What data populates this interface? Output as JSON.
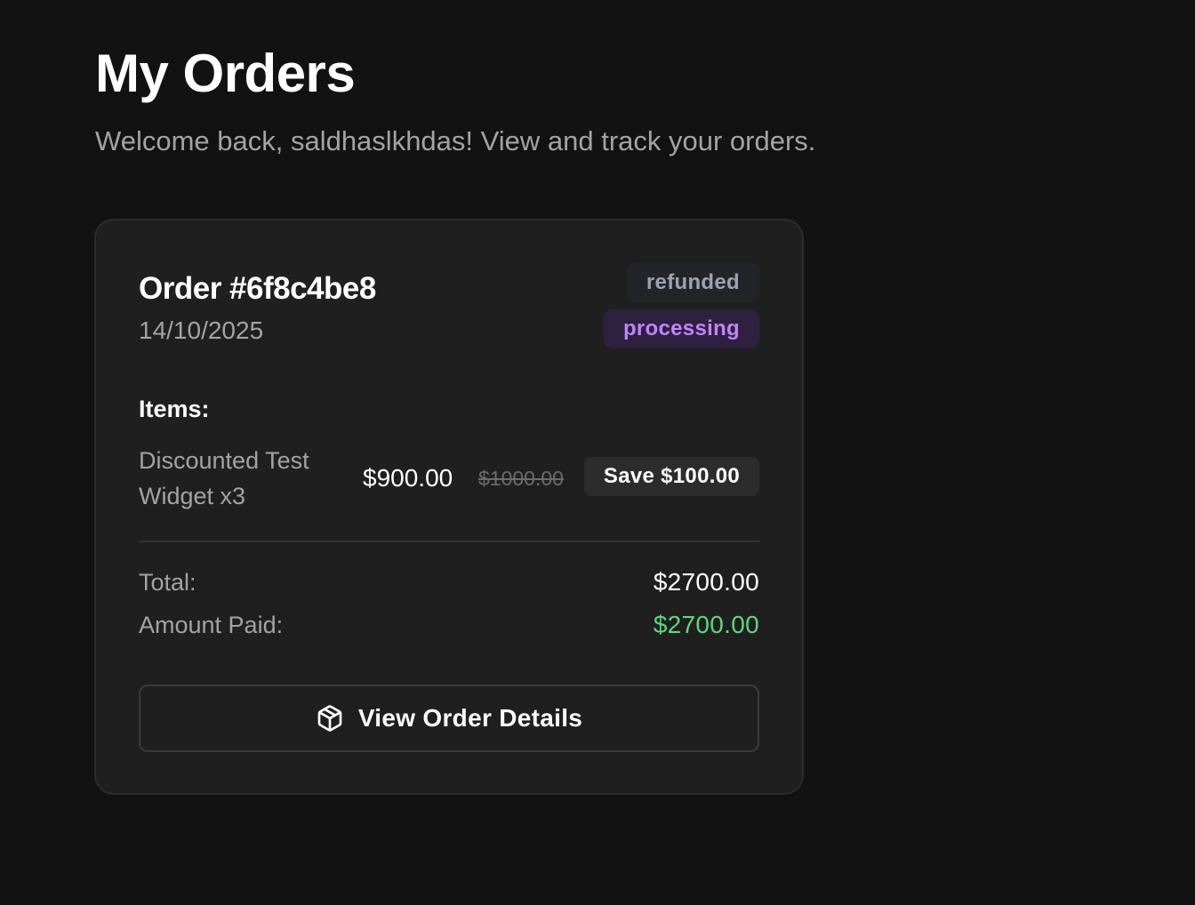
{
  "header": {
    "title": "My Orders",
    "subtitle": "Welcome back, saldhaslkhdas! View and track your orders."
  },
  "orders": [
    {
      "id_label": "Order #6f8c4be8",
      "date": "14/10/2025",
      "badges": [
        {
          "label": "refunded",
          "color": "#9ca3af"
        },
        {
          "label": "processing",
          "color": "#c084fc"
        }
      ],
      "items_heading": "Items:",
      "items": [
        {
          "name": "Discounted Test Widget x3",
          "price": "$900.00",
          "original_price": "$1000.00",
          "save_label": "Save $100.00"
        }
      ],
      "total_label": "Total:",
      "total_value": "$2700.00",
      "paid_label": "Amount Paid:",
      "paid_value": "$2700.00",
      "paid_color": "#5fd67c",
      "button_label": "View Order Details",
      "button_icon": "package-icon"
    }
  ]
}
